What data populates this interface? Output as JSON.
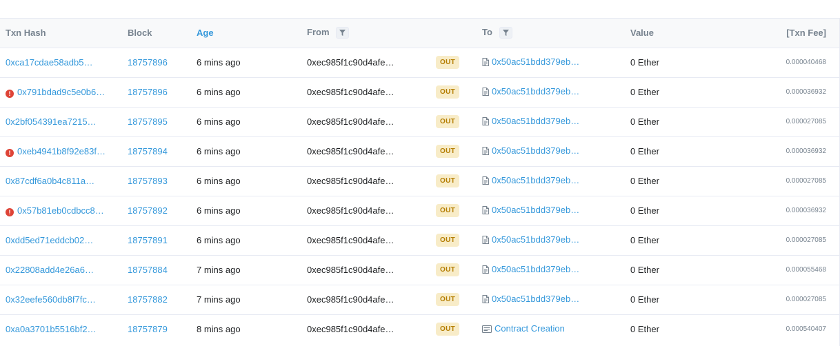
{
  "columns": {
    "txn_hash": "Txn Hash",
    "block": "Block",
    "age": "Age",
    "from": "From",
    "to": "To",
    "value": "Value",
    "fee": "[Txn Fee]"
  },
  "rows": [
    {
      "hash": "0xca17cdae58adb5…",
      "error": false,
      "block": "18757896",
      "age": "6 mins ago",
      "from": "0xec985f1c90d4afe…",
      "direction": "OUT",
      "to": "0x50ac51bdd379eb…",
      "to_type": "contract",
      "value": "0 Ether",
      "fee": "0.000040468"
    },
    {
      "hash": "0x791bdad9c5e0b6…",
      "error": true,
      "block": "18757896",
      "age": "6 mins ago",
      "from": "0xec985f1c90d4afe…",
      "direction": "OUT",
      "to": "0x50ac51bdd379eb…",
      "to_type": "contract",
      "value": "0 Ether",
      "fee": "0.000036932"
    },
    {
      "hash": "0x2bf054391ea7215…",
      "error": false,
      "block": "18757895",
      "age": "6 mins ago",
      "from": "0xec985f1c90d4afe…",
      "direction": "OUT",
      "to": "0x50ac51bdd379eb…",
      "to_type": "contract",
      "value": "0 Ether",
      "fee": "0.000027085"
    },
    {
      "hash": "0xeb4941b8f92e83f…",
      "error": true,
      "block": "18757894",
      "age": "6 mins ago",
      "from": "0xec985f1c90d4afe…",
      "direction": "OUT",
      "to": "0x50ac51bdd379eb…",
      "to_type": "contract",
      "value": "0 Ether",
      "fee": "0.000036932"
    },
    {
      "hash": "0x87cdf6a0b4c811a…",
      "error": false,
      "block": "18757893",
      "age": "6 mins ago",
      "from": "0xec985f1c90d4afe…",
      "direction": "OUT",
      "to": "0x50ac51bdd379eb…",
      "to_type": "contract",
      "value": "0 Ether",
      "fee": "0.000027085"
    },
    {
      "hash": "0x57b81eb0cdbcc8…",
      "error": true,
      "block": "18757892",
      "age": "6 mins ago",
      "from": "0xec985f1c90d4afe…",
      "direction": "OUT",
      "to": "0x50ac51bdd379eb…",
      "to_type": "contract",
      "value": "0 Ether",
      "fee": "0.000036932"
    },
    {
      "hash": "0xdd5ed71eddcb02…",
      "error": false,
      "block": "18757891",
      "age": "6 mins ago",
      "from": "0xec985f1c90d4afe…",
      "direction": "OUT",
      "to": "0x50ac51bdd379eb…",
      "to_type": "contract",
      "value": "0 Ether",
      "fee": "0.000027085"
    },
    {
      "hash": "0x22808add4e26a6…",
      "error": false,
      "block": "18757884",
      "age": "7 mins ago",
      "from": "0xec985f1c90d4afe…",
      "direction": "OUT",
      "to": "0x50ac51bdd379eb…",
      "to_type": "contract",
      "value": "0 Ether",
      "fee": "0.000055468"
    },
    {
      "hash": "0x32eefe560db8f7fc…",
      "error": false,
      "block": "18757882",
      "age": "7 mins ago",
      "from": "0xec985f1c90d4afe…",
      "direction": "OUT",
      "to": "0x50ac51bdd379eb…",
      "to_type": "contract",
      "value": "0 Ether",
      "fee": "0.000027085"
    },
    {
      "hash": "0xa0a3701b5516bf2…",
      "error": false,
      "block": "18757879",
      "age": "8 mins ago",
      "from": "0xec985f1c90d4afe…",
      "direction": "OUT",
      "to": "Contract Creation",
      "to_type": "creation",
      "value": "0 Ether",
      "fee": "0.000540407"
    }
  ],
  "colors": {
    "link": "#3498db",
    "error": "#de4437",
    "out_badge_bg": "#f8ecc8",
    "out_badge_text": "#b47d00"
  },
  "icons": {
    "error": "exclamation-circle-icon",
    "contract": "document-icon",
    "creation": "contract-creation-icon",
    "filter": "filter-icon"
  }
}
